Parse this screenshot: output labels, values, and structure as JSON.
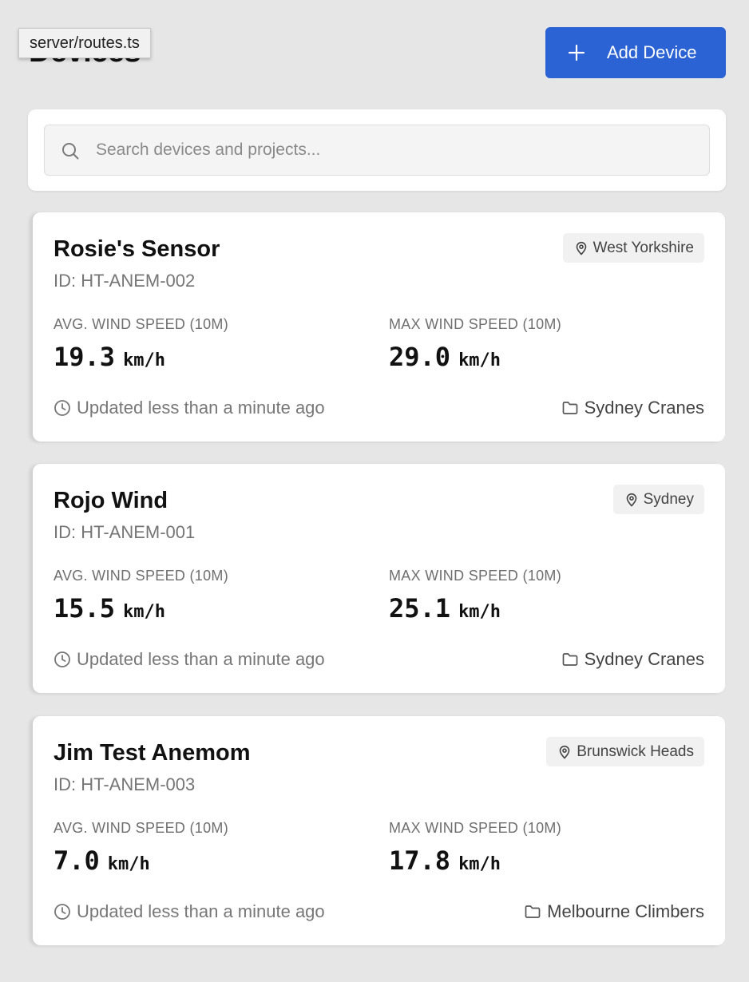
{
  "header": {
    "title": "Devices",
    "tooltip": "server/routes.ts",
    "add_button_label": "Add Device"
  },
  "search": {
    "placeholder": "Search devices and projects...",
    "value": ""
  },
  "metric_labels": {
    "avg": "AVG. WIND SPEED (10M)",
    "max": "MAX WIND SPEED (10M)"
  },
  "devices": [
    {
      "name": "Rosie's Sensor",
      "id": "ID: HT-ANEM-002",
      "location": "West Yorkshire",
      "avg_speed": "19.3",
      "max_speed": "29.0",
      "unit": "km/h",
      "updated": "Updated less than a minute ago",
      "project": "Sydney Cranes"
    },
    {
      "name": "Rojo Wind",
      "id": "ID: HT-ANEM-001",
      "location": "Sydney",
      "avg_speed": "15.5",
      "max_speed": "25.1",
      "unit": "km/h",
      "updated": "Updated less than a minute ago",
      "project": "Sydney Cranes"
    },
    {
      "name": "Jim Test Anemom",
      "id": "ID: HT-ANEM-003",
      "location": "Brunswick Heads",
      "avg_speed": "7.0",
      "max_speed": "17.8",
      "unit": "km/h",
      "updated": "Updated less than a minute ago",
      "project": "Melbourne Climbers"
    }
  ],
  "colors": {
    "background": "#e6e6e6",
    "primary_button": "#2b63d4",
    "card": "#ffffff"
  },
  "icons": {
    "add": "plus-icon",
    "search": "search-icon",
    "location": "map-pin-icon",
    "updated": "clock-icon",
    "project": "folder-icon"
  }
}
